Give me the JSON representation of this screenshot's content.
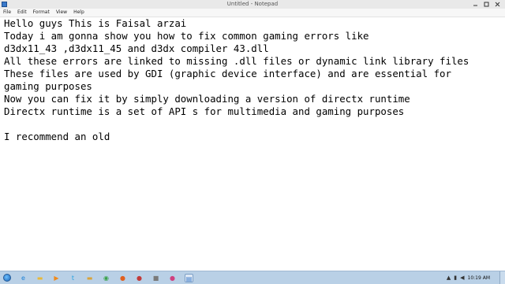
{
  "window": {
    "title": "Untitled - Notepad"
  },
  "menu": [
    "File",
    "Edit",
    "Format",
    "View",
    "Help"
  ],
  "document": {
    "lines": [
      "Hello guys This is Faisal arzai",
      "Today i am gonna show you how to fix common gaming errors like",
      "d3dx11_43 ,d3dx11_45 and d3dx compiler 43.dll",
      "All these errors are linked to missing .dll files or dynamic link library files",
      "These files are used by GDI (graphic device interface) and are essential for",
      "gaming purposes",
      "Now you can fix it by simply downloading a version of directx runtime",
      "Directx runtime is a set of API s for multimedia and gaming purposes",
      "",
      "I recommend an old"
    ]
  },
  "taskbar": {
    "icons": [
      {
        "name": "ie-icon",
        "color": "#1b7fd6",
        "glyph": "e"
      },
      {
        "name": "explorer-icon",
        "color": "#e8b83a",
        "glyph": "▬"
      },
      {
        "name": "media-player-icon",
        "color": "#f08a1c",
        "glyph": "▶"
      },
      {
        "name": "twitter-icon",
        "color": "#2aa3e0",
        "glyph": "t"
      },
      {
        "name": "folder-icon",
        "color": "#d9a33a",
        "glyph": "▬"
      },
      {
        "name": "chrome-icon",
        "color": "#3aa14a",
        "glyph": "◉"
      },
      {
        "name": "firefox-icon",
        "color": "#e06020",
        "glyph": "●"
      },
      {
        "name": "app-icon",
        "color": "#c23a3a",
        "glyph": "●"
      },
      {
        "name": "app-icon-2",
        "color": "#7a7a7a",
        "glyph": "■"
      },
      {
        "name": "media-icon",
        "color": "#d04080",
        "glyph": "●"
      },
      {
        "name": "notepad-taskbar-icon",
        "color": "#3a79c9",
        "glyph": "▤",
        "active": true
      }
    ],
    "clock": "10:19 AM"
  }
}
